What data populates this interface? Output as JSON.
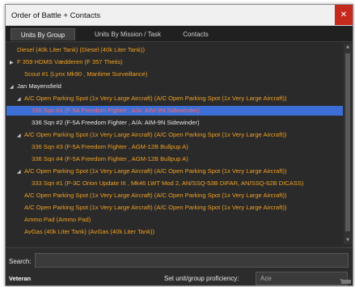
{
  "window": {
    "title": "Order of Battle + Contacts",
    "close_icon": "close-icon"
  },
  "tabs": [
    {
      "label": "Units By Group",
      "active": true
    },
    {
      "label": "Units By Mission / Task",
      "active": false
    },
    {
      "label": "Contacts",
      "active": false
    }
  ],
  "tree": [
    {
      "text": "Diesel (40k Liter Tank) (Diesel (40k Liter Tank))",
      "color": "orange",
      "expander": ""
    },
    {
      "text": "F 359 HDMS Vædderen (F 357 Thetis)",
      "color": "orange",
      "expander": "collapsed"
    },
    {
      "text": "Scout #1 (Lynx Mk90 , Maritime Surveillance)",
      "color": "orange",
      "expander": ""
    },
    {
      "text": "Jan Mayensfield",
      "color": "white",
      "expander": "expanded"
    },
    {
      "text": "A/C Open Parking Spot (1x Very Large Aircraft) (A/C Open Parking Spot (1x Very Large Aircraft))",
      "color": "orange",
      "expander": "expanded"
    },
    {
      "text": "336 Sqn #1 (F-5A Freedom Fighter , A/A: AIM-9N Sidewinder)",
      "color": "orange",
      "expander": "",
      "selected": true
    },
    {
      "text": "336 Sqn #2 (F-5A Freedom Fighter , A/A: AIM-9N Sidewinder)",
      "color": "white",
      "expander": ""
    },
    {
      "text": "A/C Open Parking Spot (1x Very Large Aircraft) (A/C Open Parking Spot (1x Very Large Aircraft))",
      "color": "orange",
      "expander": "expanded"
    },
    {
      "text": "336 Sqn #3 (F-5A Freedom Fighter , AGM-12B Bullpup A)",
      "color": "orange",
      "expander": ""
    },
    {
      "text": "336 Sqn #4 (F-5A Freedom Fighter , AGM-12B Bullpup A)",
      "color": "orange",
      "expander": ""
    },
    {
      "text": "A/C Open Parking Spot (1x Very Large Aircraft) (A/C Open Parking Spot (1x Very Large Aircraft))",
      "color": "orange",
      "expander": "expanded"
    },
    {
      "text": "333 Sqn #1 (P-3C Orion Update III , Mk46 LWT Mod 2, AN/SSQ-53B DIFAR, AN/SSQ-62B DICASS)",
      "color": "orange",
      "expander": ""
    },
    {
      "text": "A/C Open Parking Spot (1x Very Large Aircraft) (A/C Open Parking Spot (1x Very Large Aircraft))",
      "color": "orange",
      "expander": ""
    },
    {
      "text": "A/C Open Parking Spot (1x Very Large Aircraft) (A/C Open Parking Spot (1x Very Large Aircraft))",
      "color": "orange",
      "expander": ""
    },
    {
      "text": "Ammo Pad (Ammo Pad)",
      "color": "orange",
      "expander": ""
    },
    {
      "text": "AvGas (40k Liter Tank) (AvGas (40k Liter Tank))",
      "color": "orange",
      "expander": ""
    }
  ],
  "search": {
    "label": "Search:",
    "value": ""
  },
  "footer": {
    "unit_status": "Veteran",
    "proficiency_label": "Set unit/group proficiency:",
    "proficiency_value": "Ace"
  },
  "colors": {
    "orange": "#f0a020",
    "white": "#e8e8e8",
    "selection": "#3b6fd6",
    "selected_text": "#ff6666"
  }
}
